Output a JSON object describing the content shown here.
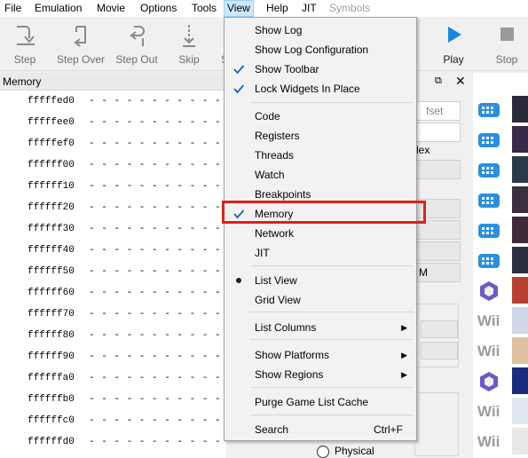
{
  "menubar": {
    "items": [
      {
        "label": "File"
      },
      {
        "label": "Emulation"
      },
      {
        "label": "Movie"
      },
      {
        "label": "Options"
      },
      {
        "label": "Tools"
      },
      {
        "label": "View"
      },
      {
        "label": "Help"
      },
      {
        "label": "JIT"
      },
      {
        "label": "Symbols"
      }
    ]
  },
  "toolbar": {
    "step": "Step",
    "step_over": "Step Over",
    "step_out": "Step Out",
    "skip": "Skip",
    "partial": "S",
    "play": "Play",
    "stop": "Stop"
  },
  "memory_panel": {
    "title": "Memory",
    "rows": [
      {
        "addr": "fffffed0",
        "vals": "- - - - - - - - - - -"
      },
      {
        "addr": "fffffee0",
        "vals": "- - - - - - - - - - -"
      },
      {
        "addr": "fffffef0",
        "vals": "- - - - - - - - - - -"
      },
      {
        "addr": "ffffff00",
        "vals": "- - - - - - - - - - -"
      },
      {
        "addr": "ffffff10",
        "vals": "- - - - - - - - - - -"
      },
      {
        "addr": "ffffff20",
        "vals": "- - - - - - - - - - -"
      },
      {
        "addr": "ffffff30",
        "vals": "- - - - - - - - - - -"
      },
      {
        "addr": "ffffff40",
        "vals": "- - - - - - - - - - -"
      },
      {
        "addr": "ffffff50",
        "vals": "- - - - - - - - - - -"
      },
      {
        "addr": "ffffff60",
        "vals": "- - - - - - - - - - -"
      },
      {
        "addr": "ffffff70",
        "vals": "- - - - - - - - - - -"
      },
      {
        "addr": "ffffff80",
        "vals": "- - - - - - - - - - -"
      },
      {
        "addr": "ffffff90",
        "vals": "- - - - - - - - - - -"
      },
      {
        "addr": "ffffffa0",
        "vals": "- - - - - - - - - - -"
      },
      {
        "addr": "ffffffb0",
        "vals": "- - - - - - - - - - -"
      },
      {
        "addr": "ffffffc0",
        "vals": "- - - - - - - - - - -"
      },
      {
        "addr": "ffffffd0",
        "vals": "- - - - - - - - - - -"
      }
    ]
  },
  "side_panel": {
    "offset_fragment": "fset",
    "hex_fragment": "lex",
    "m_fragment": "M",
    "physical_label": "Physical"
  },
  "view_menu": {
    "items": [
      {
        "label": "Show Log",
        "checked": false
      },
      {
        "label": "Show Log Configuration",
        "checked": false
      },
      {
        "label": "Show Toolbar",
        "checked": true
      },
      {
        "label": "Lock Widgets In Place",
        "checked": true
      },
      {
        "label": "Code"
      },
      {
        "label": "Registers"
      },
      {
        "label": "Threads"
      },
      {
        "label": "Watch"
      },
      {
        "label": "Breakpoints"
      },
      {
        "label": "Memory",
        "checked": true
      },
      {
        "label": "Network"
      },
      {
        "label": "JIT"
      },
      {
        "label": "List View",
        "selected": true
      },
      {
        "label": "Grid View"
      },
      {
        "label": "List Columns",
        "submenu": true
      },
      {
        "label": "Show Platforms",
        "submenu": true
      },
      {
        "label": "Show Regions",
        "submenu": true
      },
      {
        "label": "Purge Game List Cache"
      },
      {
        "label": "Search",
        "shortcut": "Ctrl+F"
      }
    ]
  },
  "game_list": {
    "platforms": [
      "wiiware",
      "wiiware",
      "wiiware",
      "wiiware",
      "wiiware",
      "wiiware",
      "gamecube",
      "wii",
      "wii",
      "gamecube",
      "wii",
      "wii"
    ],
    "wii_label": "Wii"
  },
  "colors": {
    "accent": "#1a86d9",
    "highlight": "#e0201a",
    "check": "#1565c0"
  }
}
